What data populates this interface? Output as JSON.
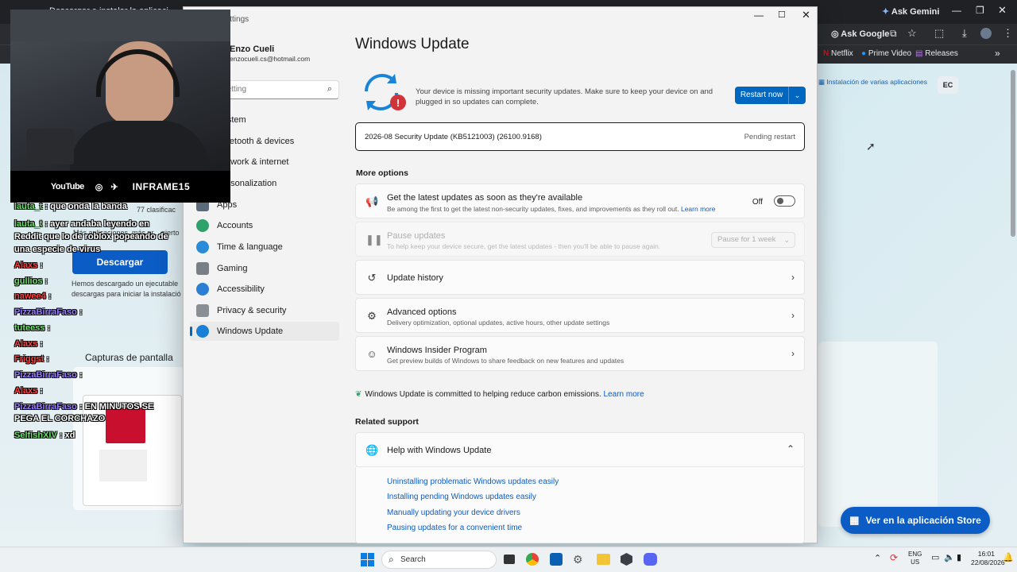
{
  "browser": {
    "tab_title": "Descargar e instalar la aplicación Windows...",
    "ask_gemini": "Ask Gemini",
    "ask_google": "Ask Google",
    "bookmarks": [
      "Netflix",
      "Prime Video",
      "Releases"
    ],
    "store_tab": "Instalación de varias aplicaciones",
    "profile_initials": "EC"
  },
  "store_page": {
    "ratings_count": "77 clasificac",
    "more_apps": "Más aplicaciones, más pr... pierto",
    "download_button": "Descargar",
    "desc_line1": "Hemos descargado un ejecutable",
    "desc_line2": "descargas para iniciar la instalació",
    "screenshots_heading": "Capturas de pantalla",
    "open_store_button": "Ver en la aplicación Store"
  },
  "webcam": {
    "youtube": "YouTube",
    "handle": "INFRAME15"
  },
  "chat": [
    {
      "user": "lauta_t",
      "msg": ": que onda la banda",
      "color": "#6ee06e"
    },
    {
      "user": "lauta_t",
      "msg": ": ayer andaba leyendo en Reddit que lo de roblox popeando de una especie de virus",
      "color": "#6ee06e"
    },
    {
      "user": "Alaxs",
      "msg": ":",
      "color": "#ff4040"
    },
    {
      "user": "gullios",
      "msg": ":",
      "color": "#6ee06e"
    },
    {
      "user": "nawee4",
      "msg": ":",
      "color": "#ff4040"
    },
    {
      "user": "PizzaBirraFaso",
      "msg": ":",
      "color": "#9a7cff"
    },
    {
      "user": "tuteess",
      "msg": ":",
      "color": "#6ee06e"
    },
    {
      "user": "Alaxs",
      "msg": ":",
      "color": "#ff4040"
    },
    {
      "user": "Friggst",
      "msg": ":",
      "color": "#ff4040"
    },
    {
      "user": "PizzaBirraFaso",
      "msg": ":",
      "color": "#9a7cff"
    },
    {
      "user": "Alaxs",
      "msg": ":",
      "color": "#ff4040"
    },
    {
      "user": "PizzaBirraFaso",
      "msg": ": EN MINUTOS SE PEGA EL CORCHAZO",
      "color": "#9a7cff"
    },
    {
      "user": "SelfishXIV",
      "msg": ": xd",
      "color": "#6ee06e"
    }
  ],
  "settings": {
    "window_title": "Settings",
    "user_name": "Enzo Cueli",
    "user_email": "enzocueli.cs@hotmail.com",
    "search_placeholder": "Find a setting",
    "nav": [
      "System",
      "Bluetooth & devices",
      "Network & internet",
      "Personalization",
      "Apps",
      "Accounts",
      "Time & language",
      "Gaming",
      "Accessibility",
      "Privacy & security",
      "Windows Update"
    ],
    "page_title": "Windows Update",
    "status_message": "Your device is missing important security updates. Make sure to keep your device on and plugged in so updates can complete.",
    "restart_button": "Restart now",
    "update_name": "2026-08 Security Update (KB5121003) (26100.9168)",
    "update_status": "Pending restart",
    "more_options": "More options",
    "latest_title": "Get the latest updates as soon as they're available",
    "latest_sub": "Be among the first to get the latest non-security updates, fixes, and improvements as they roll out.",
    "learn_more": "Learn more",
    "toggle_state": "Off",
    "pause_title": "Pause updates",
    "pause_sub": "To help keep your device secure, get the latest updates - then you'll be able to pause again.",
    "pause_select": "Pause for 1 week",
    "history_title": "Update history",
    "advanced_title": "Advanced options",
    "advanced_sub": "Delivery optimization, optional updates, active hours, other update settings",
    "insider_title": "Windows Insider Program",
    "insider_sub": "Get preview builds of Windows to share feedback on new features and updates",
    "carbon_text": "Windows Update is committed to helping reduce carbon emissions.",
    "carbon_link": "Learn more",
    "related_support": "Related support",
    "help_title": "Help with Windows Update",
    "help_links": [
      "Uninstalling problematic Windows updates easily",
      "Installing pending Windows updates easily",
      "Manually updating your device drivers",
      "Pausing updates for a convenient time"
    ]
  },
  "taskbar": {
    "search": "Search",
    "lang1": "ENG",
    "lang2": "US",
    "time": "16:01",
    "date": "22/08/2026"
  }
}
